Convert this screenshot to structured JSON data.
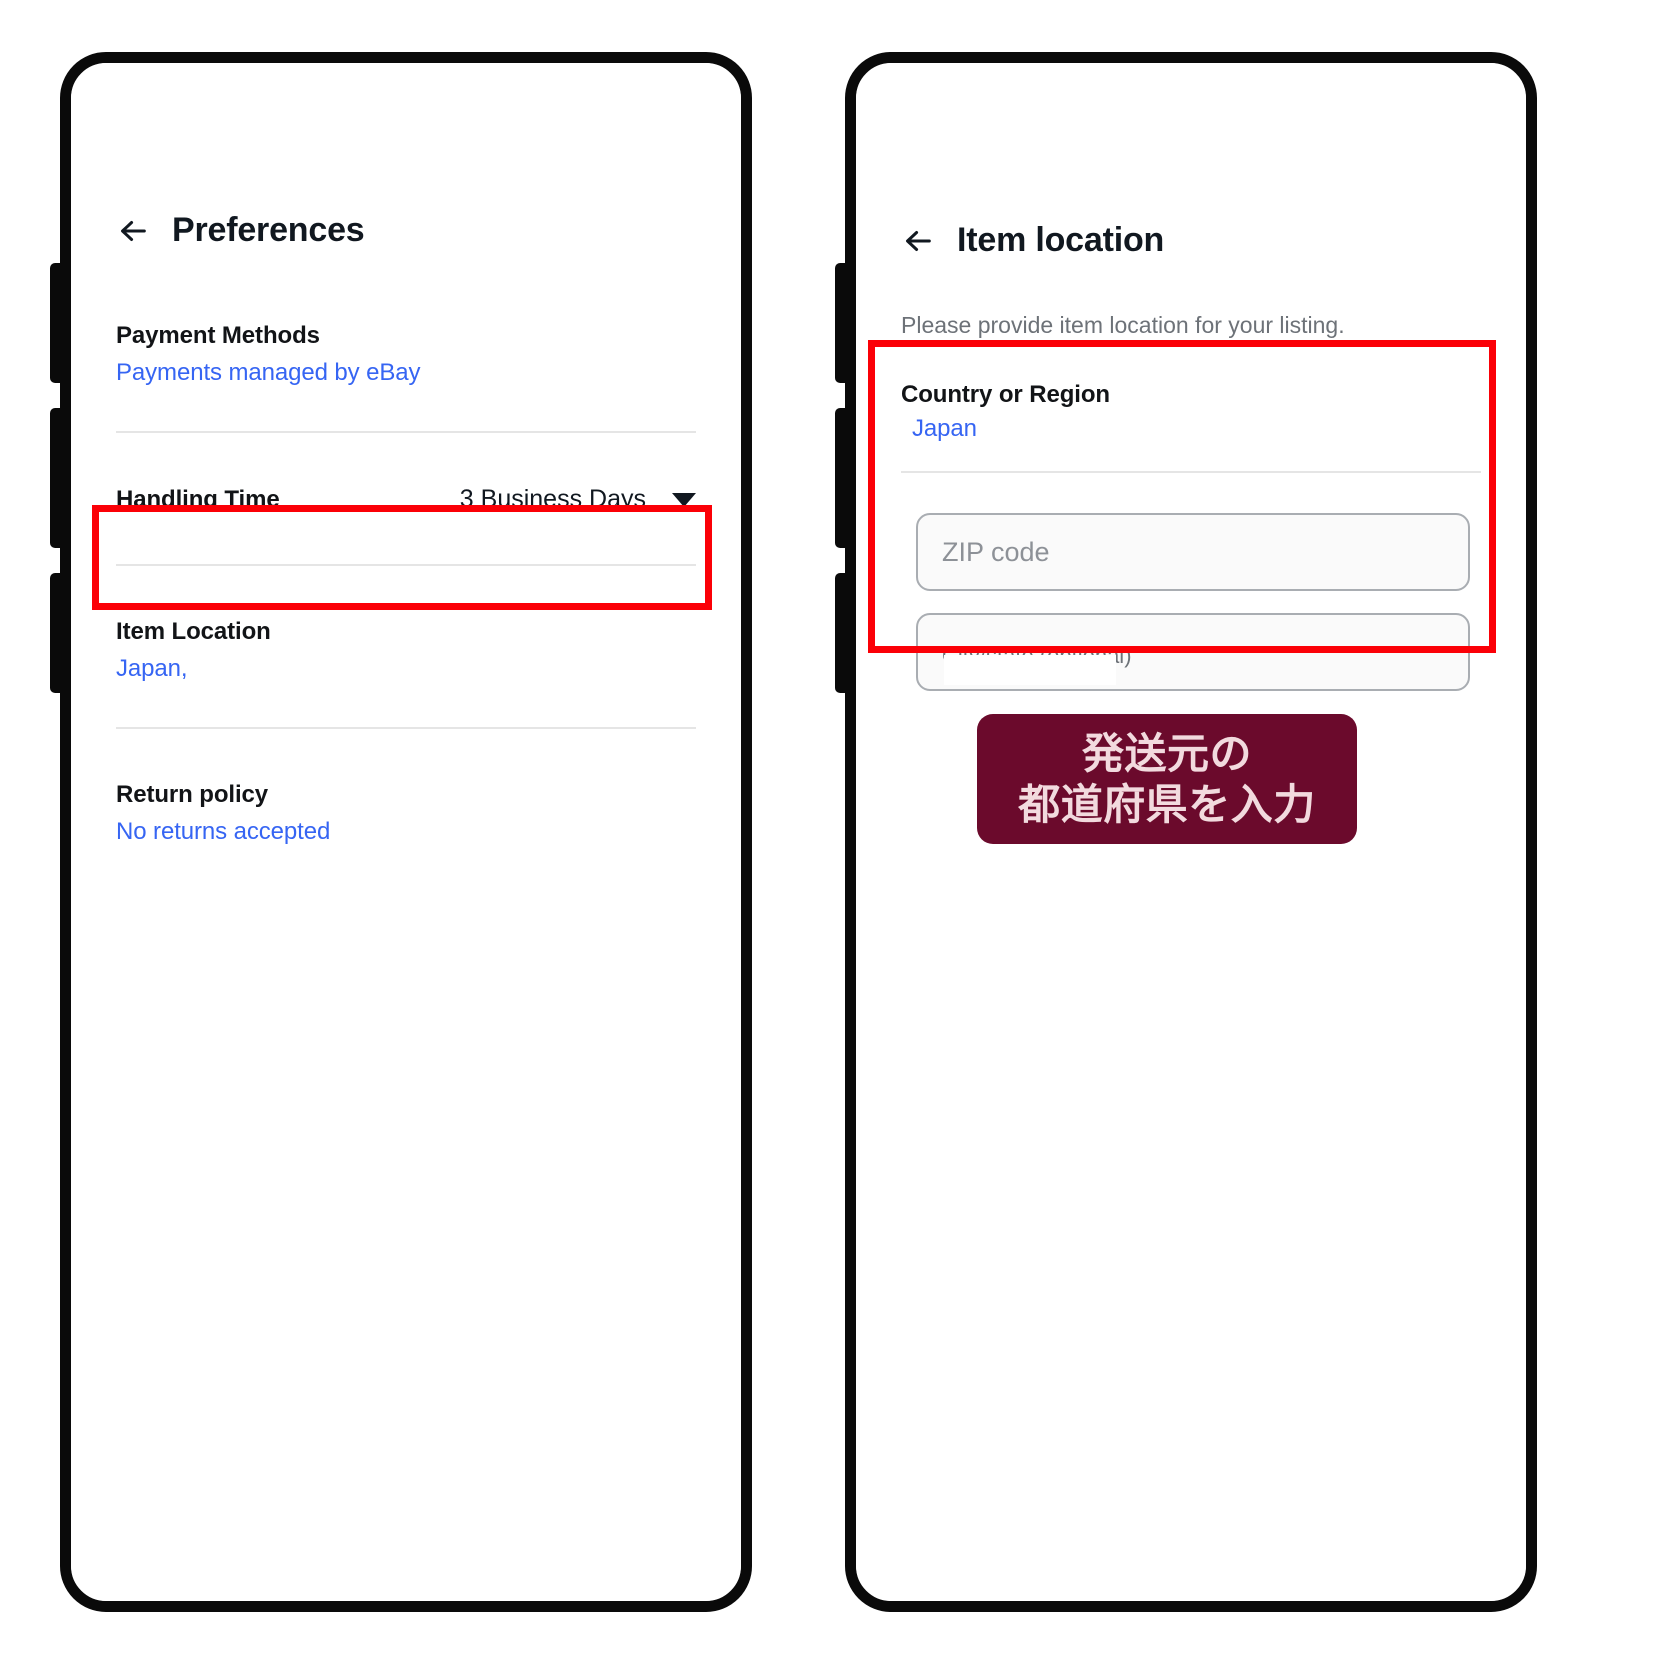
{
  "left_phone": {
    "header": {
      "back_icon": "back-arrow-icon",
      "title": "Preferences"
    },
    "rows": [
      {
        "label": "Payment Methods",
        "value": "Payments managed by eBay"
      },
      {
        "label": "Handling Time",
        "selected": "3 Business Days",
        "caret_icon": "chevron-down-icon"
      },
      {
        "label": "Item Location",
        "value": "Japan,"
      },
      {
        "label": "Return policy",
        "value": "No returns accepted"
      }
    ]
  },
  "right_phone": {
    "header": {
      "back_icon": "back-arrow-icon",
      "title": "Item location"
    },
    "subtitle": "Please provide item location for your listing.",
    "country_label": "Country or Region",
    "country_value": "Japan",
    "zip_placeholder": "ZIP code",
    "zip_value": "",
    "city_label": "City/state (optional)",
    "city_value": ""
  },
  "annotation": {
    "line1": "発送元の",
    "line2": "都道府県を入力"
  },
  "colors": {
    "link": "#3665f3",
    "highlight": "#fb0007",
    "badge_bg": "#6b0a2c",
    "badge_text": "#f2dade"
  }
}
